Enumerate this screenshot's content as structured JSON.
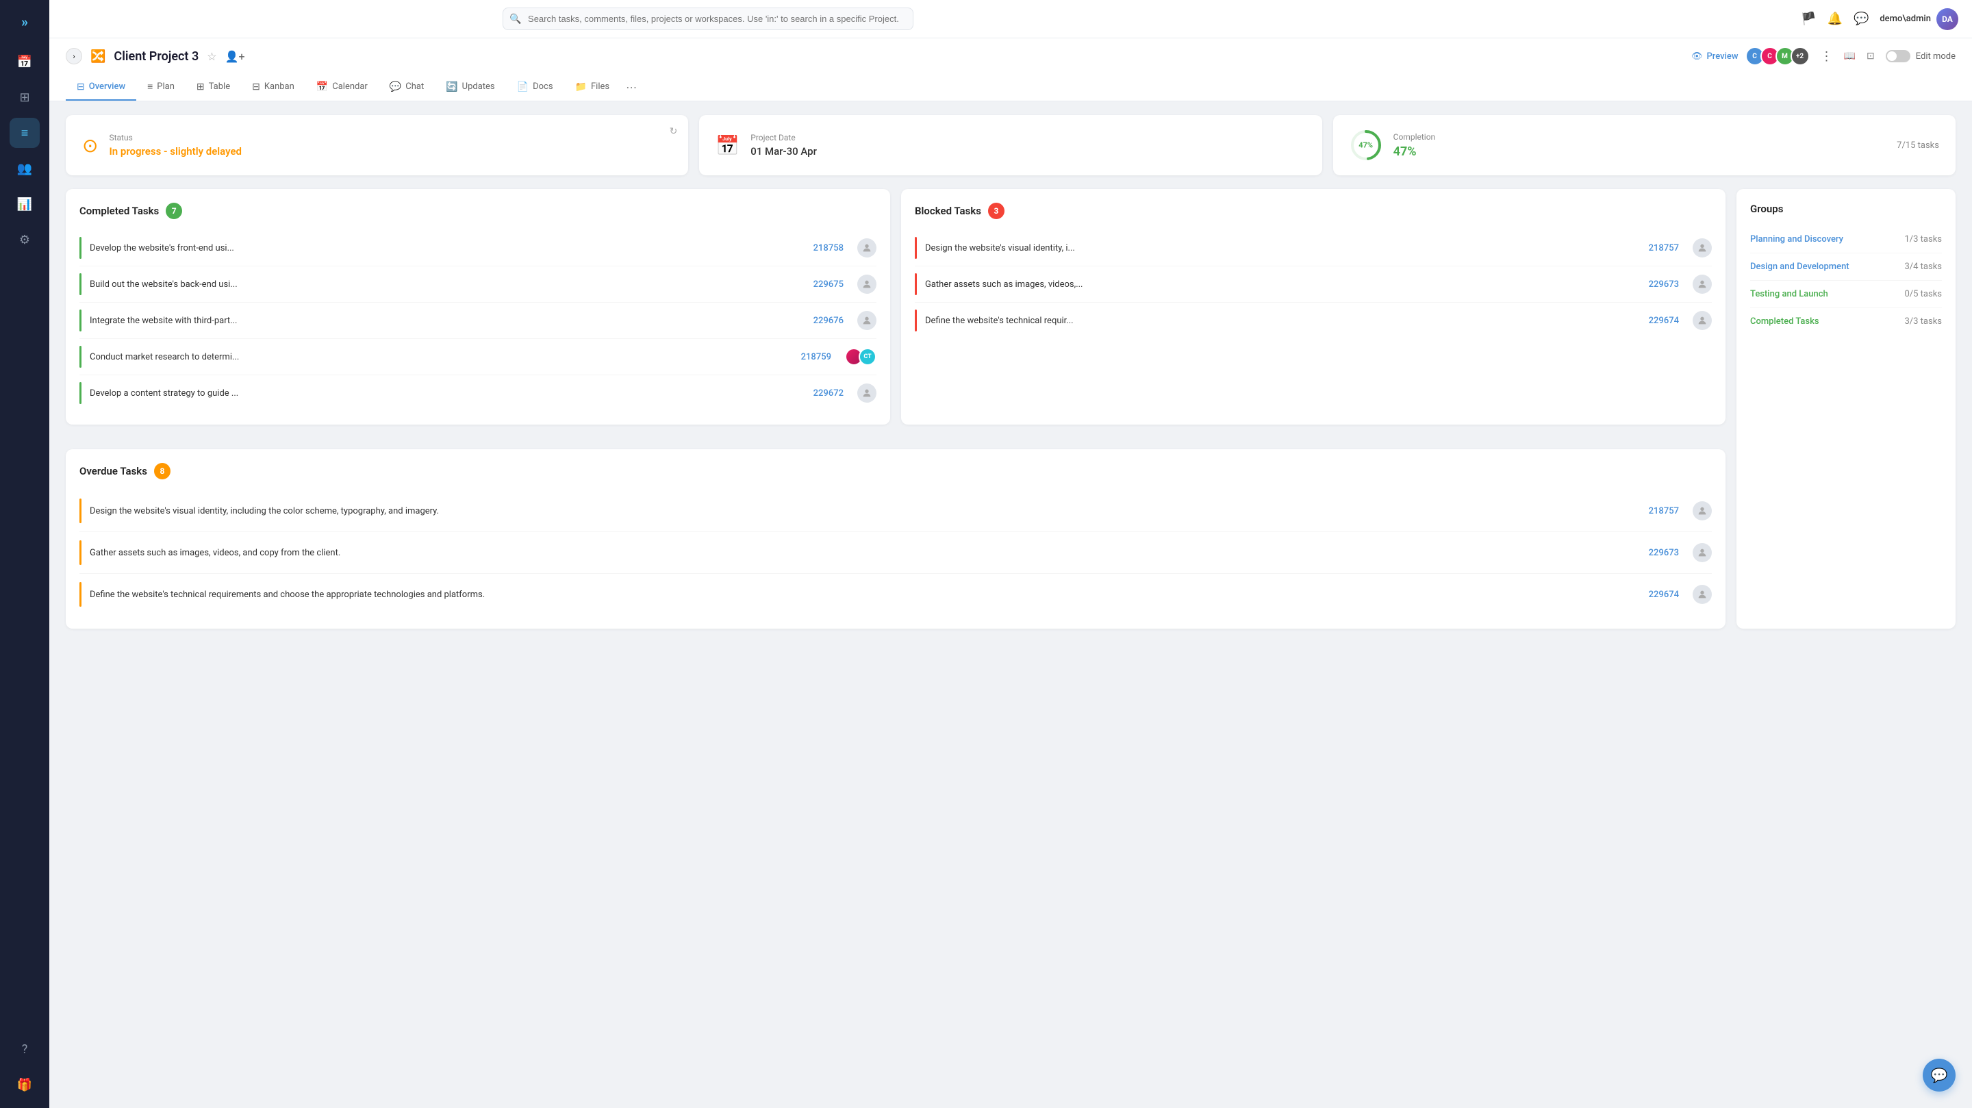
{
  "sidebar": {
    "logo": "»",
    "items": [
      {
        "id": "calendar",
        "icon": "📅",
        "active": false
      },
      {
        "id": "grid",
        "icon": "⊞",
        "active": false
      },
      {
        "id": "list",
        "icon": "≡",
        "active": true
      },
      {
        "id": "users",
        "icon": "👥",
        "active": false
      },
      {
        "id": "chart",
        "icon": "📊",
        "active": false
      },
      {
        "id": "settings",
        "icon": "⚙",
        "active": false
      }
    ],
    "bottom_items": [
      {
        "id": "help",
        "icon": "?"
      },
      {
        "id": "gift",
        "icon": "🎁"
      }
    ]
  },
  "topbar": {
    "search_placeholder": "Search tasks, comments, files, projects or workspaces. Use 'in:' to search in a specific Project.",
    "user_name": "demo\\admin"
  },
  "project": {
    "title": "Client Project 3",
    "preview_label": "Preview",
    "edit_mode_label": "Edit mode",
    "avatars": [
      "+2"
    ]
  },
  "tabs": [
    {
      "id": "overview",
      "label": "Overview",
      "active": true
    },
    {
      "id": "plan",
      "label": "Plan",
      "active": false
    },
    {
      "id": "table",
      "label": "Table",
      "active": false
    },
    {
      "id": "kanban",
      "label": "Kanban",
      "active": false
    },
    {
      "id": "calendar",
      "label": "Calendar",
      "active": false
    },
    {
      "id": "chat",
      "label": "Chat",
      "active": false
    },
    {
      "id": "updates",
      "label": "Updates",
      "active": false
    },
    {
      "id": "docs",
      "label": "Docs",
      "active": false
    },
    {
      "id": "files",
      "label": "Files",
      "active": false
    }
  ],
  "status_card": {
    "label": "Status",
    "value": "In progress - slightly delayed"
  },
  "date_card": {
    "label": "Project Date",
    "value": "01 Mar-30 Apr"
  },
  "completion_card": {
    "label": "Completion",
    "value": "47%",
    "tasks": "7/15 tasks",
    "percent": 47
  },
  "completed_tasks": {
    "title": "Completed Tasks",
    "count": 7,
    "items": [
      {
        "name": "Develop the website's front-end usi...",
        "id": "218758",
        "has_avatar": false
      },
      {
        "name": "Build out the website's back-end usi...",
        "id": "229675",
        "has_avatar": false
      },
      {
        "name": "Integrate the website with third-part...",
        "id": "229676",
        "has_avatar": false
      },
      {
        "name": "Conduct market research to determi...",
        "id": "218759",
        "has_avatar": true
      },
      {
        "name": "Develop a content strategy to guide ...",
        "id": "229672",
        "has_avatar": false
      }
    ]
  },
  "blocked_tasks": {
    "title": "Blocked Tasks",
    "count": 3,
    "items": [
      {
        "name": "Design the website's visual identity, i...",
        "id": "218757",
        "has_avatar": false
      },
      {
        "name": "Gather assets such as images, videos,...",
        "id": "229673",
        "has_avatar": false
      },
      {
        "name": "Define the website's technical requir...",
        "id": "229674",
        "has_avatar": false
      }
    ]
  },
  "overdue_tasks": {
    "title": "Overdue Tasks",
    "count": 8,
    "items": [
      {
        "name": "Design the website's visual identity, including the color scheme, typography, and imagery.",
        "id": "218757"
      },
      {
        "name": "Gather assets such as images, videos, and copy from the client.",
        "id": "229673"
      },
      {
        "name": "Define the website's technical requirements and choose the appropriate technologies and platforms.",
        "id": "229674"
      }
    ]
  },
  "groups": {
    "title": "Groups",
    "items": [
      {
        "name": "Planning and Discovery",
        "tasks": "1/3 tasks",
        "color": "blue"
      },
      {
        "name": "Design and Development",
        "tasks": "3/4 tasks",
        "color": "blue"
      },
      {
        "name": "Testing and Launch",
        "tasks": "0/5 tasks",
        "color": "green"
      },
      {
        "name": "Completed Tasks",
        "tasks": "3/3 tasks",
        "color": "green"
      }
    ]
  }
}
